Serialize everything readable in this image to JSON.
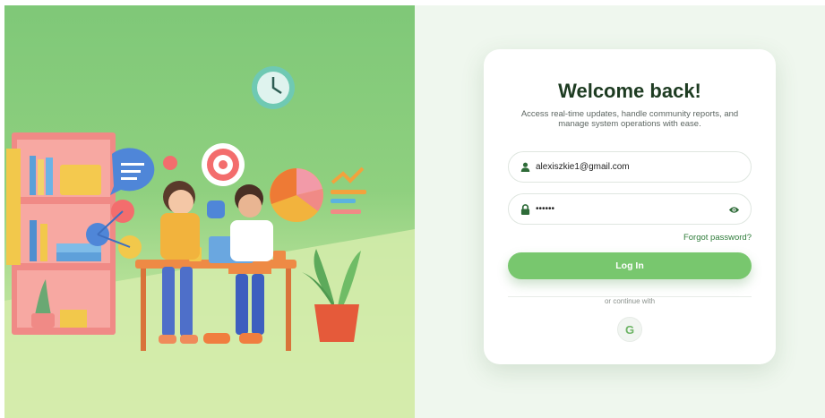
{
  "login": {
    "title": "Welcome back!",
    "subtitle": "Access real-time updates, handle community reports, and manage system operations with ease.",
    "email_value": "alexiszkie1@gmail.com",
    "password_value": "••••••",
    "forgot_label": "Forgot password?",
    "login_label": "Log In",
    "divider_label": "or continue with",
    "google_label": "G"
  },
  "icons": {
    "email": "user-icon",
    "password": "lock-icon",
    "show_password": "eye-icon",
    "google": "google-icon"
  },
  "colors": {
    "accent": "#78c76e",
    "heading": "#1d3b21",
    "link": "#2f7c3a",
    "panel_bg": "#eff7ee",
    "hero_green": "#7fc878"
  }
}
